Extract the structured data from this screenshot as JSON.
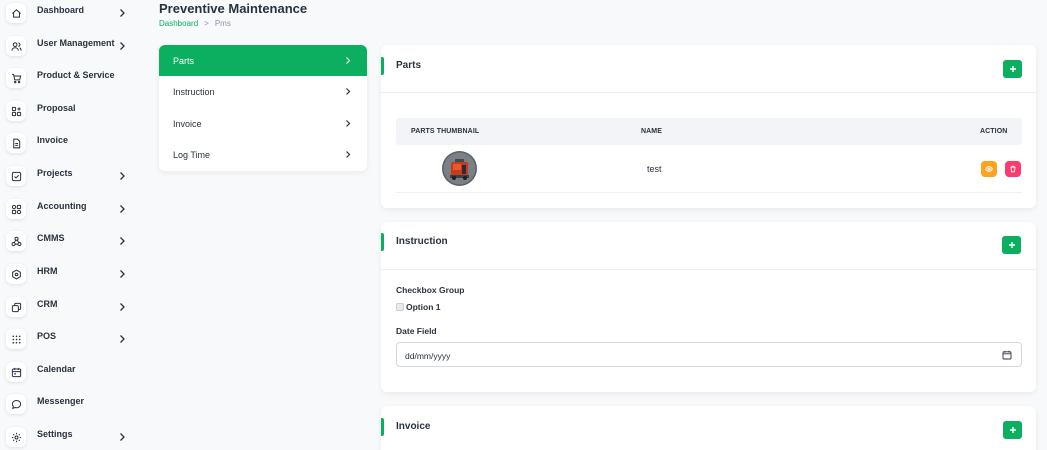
{
  "sidebar": {
    "items": [
      {
        "label": "Dashboard",
        "icon": "home-icon",
        "has_submenu": true
      },
      {
        "label": "User Management",
        "icon": "users-icon",
        "has_submenu": true
      },
      {
        "label": "Product & Service",
        "icon": "cart-icon",
        "has_submenu": false
      },
      {
        "label": "Proposal",
        "icon": "proposal-icon",
        "has_submenu": false
      },
      {
        "label": "Invoice",
        "icon": "file-icon",
        "has_submenu": false
      },
      {
        "label": "Projects",
        "icon": "checkbox-icon",
        "has_submenu": true
      },
      {
        "label": "Accounting",
        "icon": "grid-icon",
        "has_submenu": true
      },
      {
        "label": "CMMS",
        "icon": "network-icon",
        "has_submenu": true
      },
      {
        "label": "HRM",
        "icon": "hexagon-icon",
        "has_submenu": true
      },
      {
        "label": "CRM",
        "icon": "layers-icon",
        "has_submenu": true
      },
      {
        "label": "POS",
        "icon": "dots-grid-icon",
        "has_submenu": true
      },
      {
        "label": "Calendar",
        "icon": "calendar-icon",
        "has_submenu": false
      },
      {
        "label": "Messenger",
        "icon": "chat-icon",
        "has_submenu": false
      },
      {
        "label": "Settings",
        "icon": "gear-icon",
        "has_submenu": true
      }
    ]
  },
  "header": {
    "title": "Preventive Maintenance",
    "breadcrumb": {
      "home": "Dashboard",
      "separator": ">",
      "current": "Pms"
    }
  },
  "menu": {
    "items": [
      {
        "label": "Parts",
        "active": true
      },
      {
        "label": "Instruction",
        "active": false
      },
      {
        "label": "Invoice",
        "active": false
      },
      {
        "label": "Log Time",
        "active": false
      }
    ]
  },
  "parts": {
    "title": "Parts",
    "columns": {
      "thumbnail": "PARTS THUMBNAIL",
      "name": "NAME",
      "action": "ACTION"
    },
    "rows": [
      {
        "name": "test",
        "thumbnail": "part-photo"
      }
    ]
  },
  "instruction": {
    "title": "Instruction",
    "checkbox_group_label": "Checkbox Group",
    "option_label": "Option 1",
    "option_checked": false,
    "date_label": "Date Field",
    "date_placeholder": "dd/mm/yyyy"
  },
  "invoice": {
    "title": "Invoice"
  },
  "colors": {
    "accent": "#0caf60",
    "view_button": "#ffa21d",
    "delete_button": "#ff3a6e",
    "background": "#f8f9fa",
    "text": "#293240"
  }
}
